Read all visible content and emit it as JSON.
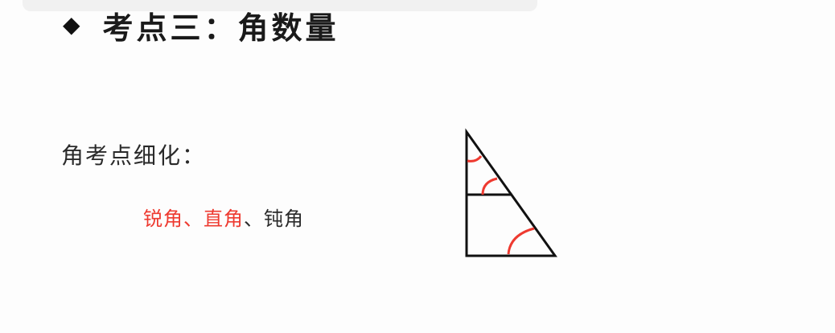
{
  "slide": {
    "bullet_icon": "diamond-icon",
    "title": "考点三：角数量",
    "subtitle": "角考点细化：",
    "angle_types": [
      {
        "text": "锐角",
        "color": "#ee3a30"
      },
      {
        "text": "、",
        "color": "#ee3a30"
      },
      {
        "text": "直角",
        "color": "#ee3a30"
      },
      {
        "text": "、",
        "color": "#2a2a2a"
      },
      {
        "text": "钝角",
        "color": "#2a2a2a"
      }
    ]
  },
  "colors": {
    "title": "#1a1a1a",
    "highlight": "#ee3a30",
    "text": "#2a2a2a",
    "figure_stroke": "#111111"
  },
  "figure": {
    "icon": "triangle-figure-icon"
  }
}
